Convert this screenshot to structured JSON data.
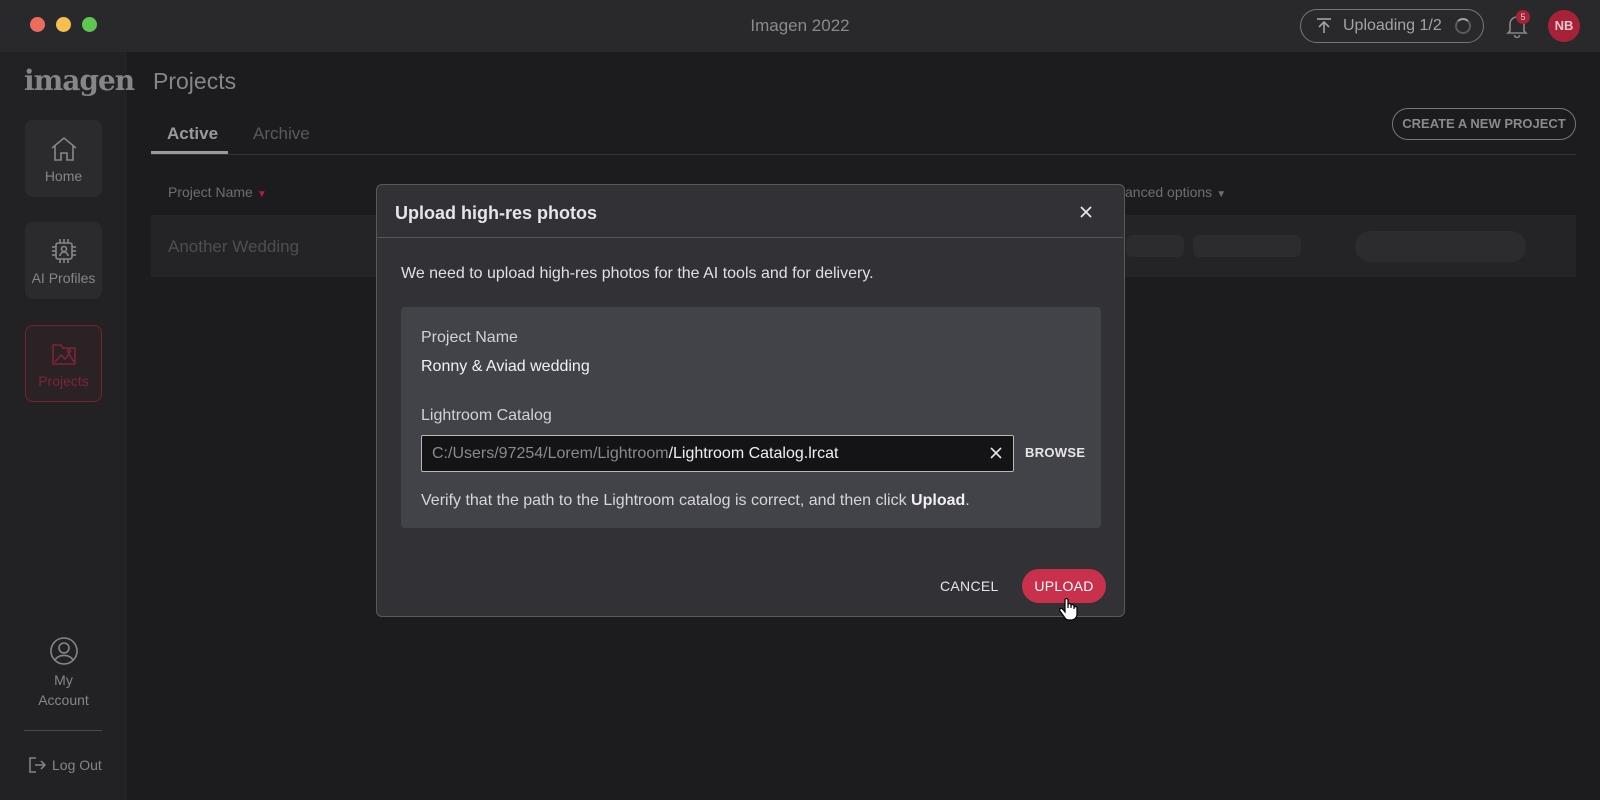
{
  "window": {
    "title": "Imagen 2022"
  },
  "header": {
    "upload_status": "Uploading 1/2",
    "notifications_count": "5",
    "avatar_initials": "NB",
    "icons": [
      "upload-arrow-icon",
      "spinner-icon",
      "bell-icon"
    ]
  },
  "sidebar": {
    "logo": "imagen",
    "items": [
      {
        "label": "Home",
        "icon": "home-icon"
      },
      {
        "label": "AI Profiles",
        "icon": "chip-icon"
      },
      {
        "label": "Projects",
        "icon": "image-folder-icon",
        "active": true
      }
    ],
    "account_line1": "My",
    "account_line2": "Account",
    "logout": "Log Out"
  },
  "main": {
    "title": "Projects",
    "tabs": [
      {
        "label": "Active",
        "active": true
      },
      {
        "label": "Archive"
      }
    ],
    "create_button": "CREATE A NEW PROJECT",
    "columns": {
      "project_name": "Project Name",
      "advanced": "vanced options"
    },
    "rows": [
      {
        "name": "Another Wedding"
      }
    ]
  },
  "modal": {
    "title": "Upload high-res photos",
    "intro": "We need to upload high-res photos for the AI tools and for delivery.",
    "project_name_label": "Project Name",
    "project_name_value": "Ronny & Aviad wedding",
    "catalog_label": "Lightroom Catalog",
    "catalog_dir": "C:/Users/97254/Lorem/Lightroom",
    "catalog_file": "/Lightroom Catalog.lrcat",
    "browse": "BROWSE",
    "verify_prefix": "Verify that the path to the Lightroom catalog is correct, and then click ",
    "verify_bold": "Upload",
    "verify_suffix": ".",
    "cancel": "CANCEL",
    "upload": "UPLOAD"
  },
  "colors": {
    "accent": "#c8304c",
    "accent_dark": "#a52238",
    "background": "#1c1c1e",
    "modal_bg": "#323236",
    "panel_bg": "#424249"
  }
}
